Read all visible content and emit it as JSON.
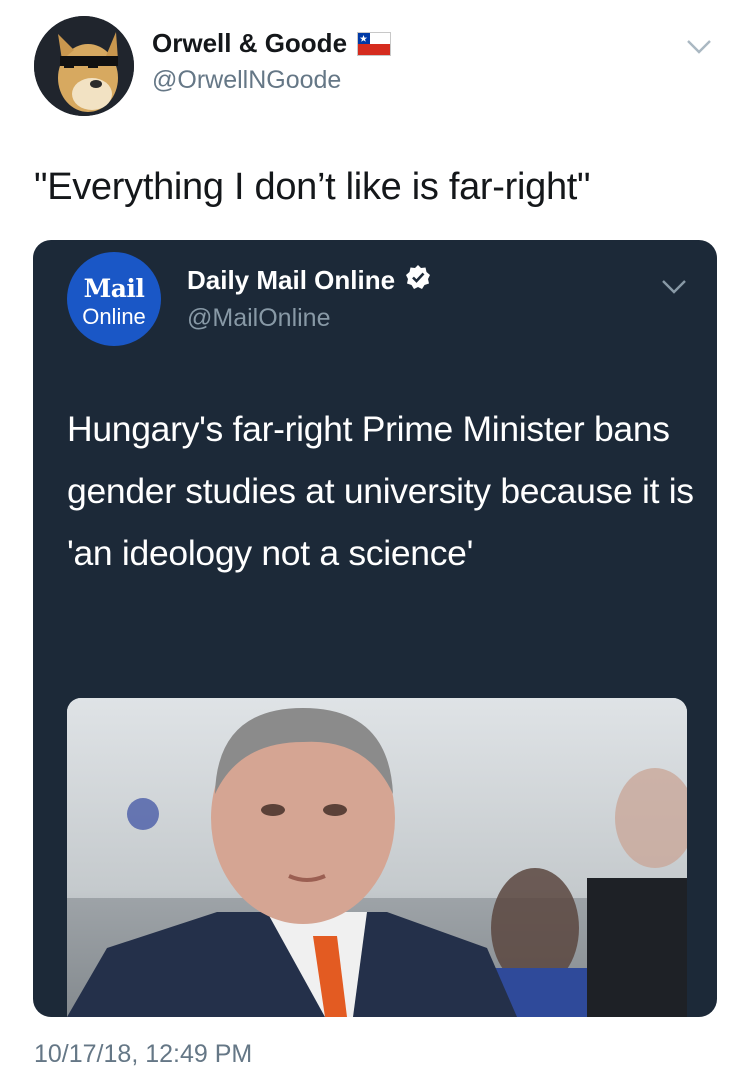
{
  "tweet": {
    "author": {
      "display_name": "Orwell & Goode",
      "handle": "@OrwellNGoode",
      "avatar_icon": "doge-sunglasses-avatar",
      "flag_icon": "chile-flag-icon"
    },
    "text": "\"Everything I don’t like is far-right\"",
    "timestamp": "10/17/18, 12:49 PM"
  },
  "quoted_tweet": {
    "author": {
      "display_name": "Daily Mail Online",
      "handle": "@MailOnline",
      "logo_word_1": "Mail",
      "logo_word_2": "Online",
      "verified_icon": "verified-badge-icon"
    },
    "text": "Hungary's far-right Prime Minister bans gender studies at university because it is 'an ideology not a science'",
    "media": "photo-of-politician"
  },
  "colors": {
    "card_background": "#1c2938",
    "mail_logo_blue": "#1a57c6",
    "secondary_text": "#657786"
  }
}
